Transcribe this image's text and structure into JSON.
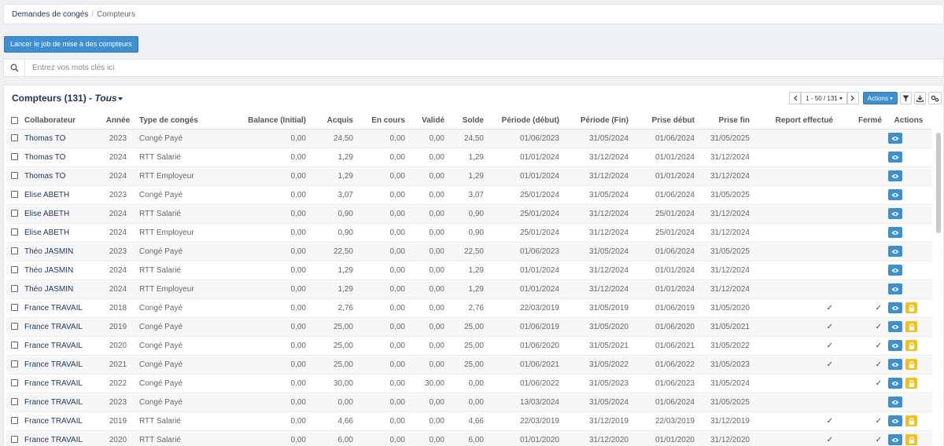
{
  "breadcrumb": {
    "root": "Demandes de congés",
    "separator": "/",
    "current": "Compteurs"
  },
  "toolbar": {
    "job_button": "Lancer le job de mise à des compteurs"
  },
  "search": {
    "placeholder": "Entrez vos mots clés ici",
    "value": ""
  },
  "panel": {
    "title": "Compteurs (131) -",
    "filter": "Tous",
    "pagination": "1 - 50 / 131",
    "actions_label": "Actions"
  },
  "colors": {
    "primary": "#3d8fd1",
    "lock": "#f4c01f",
    "title": "#1d3557"
  },
  "table": {
    "headers": [
      "Collaborateur",
      "Année",
      "Type de congés",
      "Balance (Initial)",
      "Acquis",
      "En cours",
      "Validé",
      "Solde",
      "Période (début)",
      "Période (Fin)",
      "Prise début",
      "Prise fin",
      "Report effectué",
      "Fermé",
      "Actions"
    ],
    "rows": [
      {
        "collab": "Thomas TO",
        "annee": "2023",
        "type": "Congé Payé",
        "balance": "0,00",
        "acquis": "24,50",
        "encours": "0,00",
        "valide": "0,00",
        "solde": "24,50",
        "pdebut": "01/06/2023",
        "pfin": "31/05/2024",
        "prdebut": "01/06/2024",
        "prfin": "31/05/2025",
        "report": "",
        "ferme": "",
        "lock": false
      },
      {
        "collab": "Thomas TO",
        "annee": "2024",
        "type": "RTT Salarié",
        "balance": "0,00",
        "acquis": "1,29",
        "encours": "0,00",
        "valide": "0,00",
        "solde": "1,29",
        "pdebut": "01/01/2024",
        "pfin": "31/12/2024",
        "prdebut": "01/01/2024",
        "prfin": "31/12/2024",
        "report": "",
        "ferme": "",
        "lock": false
      },
      {
        "collab": "Thomas TO",
        "annee": "2024",
        "type": "RTT Employeur",
        "balance": "0,00",
        "acquis": "1,29",
        "encours": "0,00",
        "valide": "0,00",
        "solde": "1,29",
        "pdebut": "01/01/2024",
        "pfin": "31/12/2024",
        "prdebut": "01/01/2024",
        "prfin": "31/12/2024",
        "report": "",
        "ferme": "",
        "lock": false
      },
      {
        "collab": "Elise ABETH",
        "annee": "2023",
        "type": "Congé Payé",
        "balance": "0,00",
        "acquis": "3,07",
        "encours": "0,00",
        "valide": "0,00",
        "solde": "3,07",
        "pdebut": "25/01/2024",
        "pfin": "31/05/2024",
        "prdebut": "01/06/2024",
        "prfin": "31/05/2025",
        "report": "",
        "ferme": "",
        "lock": false
      },
      {
        "collab": "Elise ABETH",
        "annee": "2024",
        "type": "RTT Salarié",
        "balance": "0,00",
        "acquis": "0,90",
        "encours": "0,00",
        "valide": "0,00",
        "solde": "0,90",
        "pdebut": "25/01/2024",
        "pfin": "31/12/2024",
        "prdebut": "25/01/2024",
        "prfin": "31/12/2024",
        "report": "",
        "ferme": "",
        "lock": false
      },
      {
        "collab": "Elise ABETH",
        "annee": "2024",
        "type": "RTT Employeur",
        "balance": "0,00",
        "acquis": "0,90",
        "encours": "0,00",
        "valide": "0,00",
        "solde": "0,90",
        "pdebut": "25/01/2024",
        "pfin": "31/12/2024",
        "prdebut": "25/01/2024",
        "prfin": "31/12/2024",
        "report": "",
        "ferme": "",
        "lock": false
      },
      {
        "collab": "Théo JASMIN",
        "annee": "2023",
        "type": "Congé Payé",
        "balance": "0,00",
        "acquis": "22,50",
        "encours": "0,00",
        "valide": "0,00",
        "solde": "22,50",
        "pdebut": "01/06/2023",
        "pfin": "31/05/2024",
        "prdebut": "01/06/2024",
        "prfin": "31/05/2025",
        "report": "",
        "ferme": "",
        "lock": false
      },
      {
        "collab": "Théo JASMIN",
        "annee": "2024",
        "type": "RTT Salarié",
        "balance": "0,00",
        "acquis": "1,29",
        "encours": "0,00",
        "valide": "0,00",
        "solde": "1,29",
        "pdebut": "01/01/2024",
        "pfin": "31/12/2024",
        "prdebut": "01/01/2024",
        "prfin": "31/12/2024",
        "report": "",
        "ferme": "",
        "lock": false
      },
      {
        "collab": "Théo JASMIN",
        "annee": "2024",
        "type": "RTT Employeur",
        "balance": "0,00",
        "acquis": "1,29",
        "encours": "0,00",
        "valide": "0,00",
        "solde": "1,29",
        "pdebut": "01/01/2024",
        "pfin": "31/12/2024",
        "prdebut": "01/01/2024",
        "prfin": "31/12/2024",
        "report": "",
        "ferme": "",
        "lock": false
      },
      {
        "collab": "France TRAVAIL",
        "annee": "2018",
        "type": "Congé Payé",
        "balance": "0,00",
        "acquis": "2,76",
        "encours": "0,00",
        "valide": "0,00",
        "solde": "2,76",
        "pdebut": "22/03/2019",
        "pfin": "31/05/2019",
        "prdebut": "01/06/2019",
        "prfin": "31/05/2020",
        "report": "✓",
        "ferme": "✓",
        "lock": true
      },
      {
        "collab": "France TRAVAIL",
        "annee": "2019",
        "type": "Congé Payé",
        "balance": "0,00",
        "acquis": "25,00",
        "encours": "0,00",
        "valide": "0,00",
        "solde": "25,00",
        "pdebut": "01/06/2019",
        "pfin": "31/05/2020",
        "prdebut": "01/06/2020",
        "prfin": "31/05/2021",
        "report": "✓",
        "ferme": "✓",
        "lock": true
      },
      {
        "collab": "France TRAVAIL",
        "annee": "2020",
        "type": "Congé Payé",
        "balance": "0,00",
        "acquis": "25,00",
        "encours": "0,00",
        "valide": "0,00",
        "solde": "25,00",
        "pdebut": "01/06/2020",
        "pfin": "31/05/2021",
        "prdebut": "01/06/2021",
        "prfin": "31/05/2022",
        "report": "✓",
        "ferme": "✓",
        "lock": true
      },
      {
        "collab": "France TRAVAIL",
        "annee": "2021",
        "type": "Congé Payé",
        "balance": "0,00",
        "acquis": "25,00",
        "encours": "0,00",
        "valide": "0,00",
        "solde": "25,00",
        "pdebut": "01/06/2021",
        "pfin": "31/05/2022",
        "prdebut": "01/06/2022",
        "prfin": "31/05/2023",
        "report": "✓",
        "ferme": "✓",
        "lock": true
      },
      {
        "collab": "France TRAVAIL",
        "annee": "2022",
        "type": "Congé Payé",
        "balance": "0,00",
        "acquis": "30,00",
        "encours": "0,00",
        "valide": "30,00",
        "solde": "0,00",
        "pdebut": "01/06/2022",
        "pfin": "31/05/2023",
        "prdebut": "01/06/2023",
        "prfin": "31/05/2024",
        "report": "",
        "ferme": "✓",
        "lock": true
      },
      {
        "collab": "France TRAVAIL",
        "annee": "2023",
        "type": "Congé Payé",
        "balance": "0,00",
        "acquis": "0,00",
        "encours": "0,00",
        "valide": "0,00",
        "solde": "0,00",
        "pdebut": "13/03/2024",
        "pfin": "31/05/2024",
        "prdebut": "01/06/2024",
        "prfin": "31/05/2025",
        "report": "",
        "ferme": "",
        "lock": false
      },
      {
        "collab": "France TRAVAIL",
        "annee": "2019",
        "type": "RTT Salarié",
        "balance": "0,00",
        "acquis": "4,66",
        "encours": "0,00",
        "valide": "0,00",
        "solde": "4,66",
        "pdebut": "22/03/2019",
        "pfin": "31/12/2019",
        "prdebut": "22/03/2019",
        "prfin": "31/12/2019",
        "report": "✓",
        "ferme": "✓",
        "lock": true
      },
      {
        "collab": "France TRAVAIL",
        "annee": "2020",
        "type": "RTT Salarié",
        "balance": "0,00",
        "acquis": "6,00",
        "encours": "0,00",
        "valide": "0,00",
        "solde": "6,00",
        "pdebut": "01/01/2020",
        "pfin": "31/12/2020",
        "prdebut": "01/01/2020",
        "prfin": "31/12/2020",
        "report": "✓",
        "ferme": "✓",
        "lock": true
      }
    ]
  }
}
